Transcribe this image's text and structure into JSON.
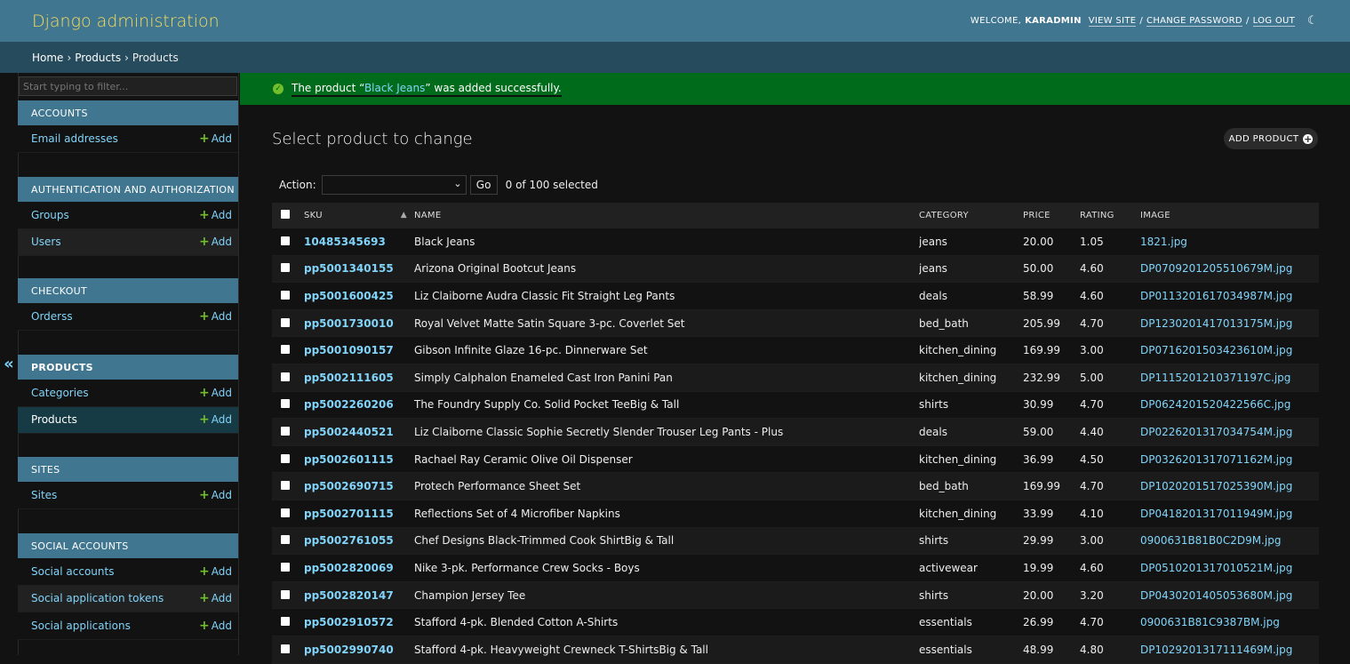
{
  "header": {
    "branding": "Django administration",
    "welcome": "WELCOME,",
    "username": "KARADMIN",
    "view_site": "VIEW SITE",
    "change_password": "CHANGE PASSWORD",
    "log_out": "LOG OUT",
    "sep": "/"
  },
  "breadcrumbs": [
    "Home",
    "Products",
    "Products"
  ],
  "sidebar": {
    "toggle": "«",
    "filter_placeholder": "Start typing to filter...",
    "add_label": "Add",
    "modules": [
      {
        "caption": "ACCOUNTS",
        "models": [
          "Email addresses"
        ]
      },
      {
        "caption": "AUTHENTICATION AND AUTHORIZATION",
        "models": [
          "Groups",
          "Users"
        ]
      },
      {
        "caption": "CHECKOUT",
        "models": [
          "Orderss"
        ]
      },
      {
        "caption": "PRODUCTS",
        "models": [
          "Categories",
          "Products"
        ]
      },
      {
        "caption": "SITES",
        "models": [
          "Sites"
        ]
      },
      {
        "caption": "SOCIAL ACCOUNTS",
        "models": [
          "Social accounts",
          "Social application tokens",
          "Social applications"
        ]
      }
    ]
  },
  "message": {
    "prefix": "The product “",
    "link": "Black Jeans",
    "suffix": "” was added successfully."
  },
  "content": {
    "title": "Select product to change",
    "add_button": "ADD PRODUCT"
  },
  "actions": {
    "label": "Action:",
    "selected": "",
    "go": "Go",
    "counter": "0 of 100 selected"
  },
  "table": {
    "columns": [
      "SKU",
      "NAME",
      "CATEGORY",
      "PRICE",
      "RATING",
      "IMAGE"
    ],
    "rows": [
      {
        "sku": "10485345693",
        "name": "Black Jeans",
        "category": "jeans",
        "price": "20.00",
        "rating": "1.05",
        "image": "1821.jpg"
      },
      {
        "sku": "pp5001340155",
        "name": "Arizona Original Bootcut Jeans",
        "category": "jeans",
        "price": "50.00",
        "rating": "4.60",
        "image": "DP0709201205510679M.jpg"
      },
      {
        "sku": "pp5001600425",
        "name": "Liz Claiborne Audra Classic Fit Straight Leg Pants",
        "category": "deals",
        "price": "58.99",
        "rating": "4.60",
        "image": "DP0113201617034987M.jpg"
      },
      {
        "sku": "pp5001730010",
        "name": "Royal Velvet Matte Satin Square 3-pc. Coverlet Set",
        "category": "bed_bath",
        "price": "205.99",
        "rating": "4.70",
        "image": "DP1230201417013175M.jpg"
      },
      {
        "sku": "pp5001090157",
        "name": "Gibson Infinite Glaze 16-pc. Dinnerware Set",
        "category": "kitchen_dining",
        "price": "169.99",
        "rating": "3.00",
        "image": "DP0716201503423610M.jpg"
      },
      {
        "sku": "pp5002111605",
        "name": "Simply Calphalon Enameled Cast Iron Panini Pan",
        "category": "kitchen_dining",
        "price": "232.99",
        "rating": "5.00",
        "image": "DP1115201210371197C.jpg"
      },
      {
        "sku": "pp5002260206",
        "name": "The Foundry Supply Co. Solid Pocket TeeBig & Tall",
        "category": "shirts",
        "price": "30.99",
        "rating": "4.70",
        "image": "DP0624201520422566C.jpg"
      },
      {
        "sku": "pp5002440521",
        "name": "Liz Claiborne Classic Sophie Secretly Slender Trouser Leg Pants - Plus",
        "category": "deals",
        "price": "59.00",
        "rating": "4.40",
        "image": "DP0226201317034754M.jpg"
      },
      {
        "sku": "pp5002601115",
        "name": "Rachael Ray Ceramic Olive Oil Dispenser",
        "category": "kitchen_dining",
        "price": "36.99",
        "rating": "4.50",
        "image": "DP0326201317071162M.jpg"
      },
      {
        "sku": "pp5002690715",
        "name": "Protech Performance Sheet Set",
        "category": "bed_bath",
        "price": "169.99",
        "rating": "4.70",
        "image": "DP1020201517025390M.jpg"
      },
      {
        "sku": "pp5002701115",
        "name": "Reflections Set of 4 Microfiber Napkins",
        "category": "kitchen_dining",
        "price": "33.99",
        "rating": "4.10",
        "image": "DP0418201317011949M.jpg"
      },
      {
        "sku": "pp5002761055",
        "name": "Chef Designs Black-Trimmed Cook ShirtBig & Tall",
        "category": "shirts",
        "price": "29.99",
        "rating": "3.00",
        "image": "0900631B81B0C2D9M.jpg"
      },
      {
        "sku": "pp5002820069",
        "name": "Nike 3-pk. Performance Crew Socks - Boys",
        "category": "activewear",
        "price": "19.99",
        "rating": "4.60",
        "image": "DP0510201317010521M.jpg"
      },
      {
        "sku": "pp5002820147",
        "name": "Champion Jersey Tee",
        "category": "shirts",
        "price": "20.00",
        "rating": "3.20",
        "image": "DP0430201405053680M.jpg"
      },
      {
        "sku": "pp5002910572",
        "name": "Stafford 4-pk. Blended Cotton A-Shirts",
        "category": "essentials",
        "price": "26.99",
        "rating": "4.70",
        "image": "0900631B81C9387BM.jpg"
      },
      {
        "sku": "pp5002990740",
        "name": "Stafford 4-pk. Heavyweight Crewneck T-ShirtsBig & Tall",
        "category": "essentials",
        "price": "48.99",
        "rating": "4.80",
        "image": "DP1029201317111469M.jpg"
      }
    ]
  },
  "colors": {
    "header": "#417690",
    "breadcrumbs": "#264b5d",
    "branding": "#f5dd5d",
    "link": "#81d4fa",
    "success": "#006b1b",
    "add_plus": "#70bf2b"
  }
}
